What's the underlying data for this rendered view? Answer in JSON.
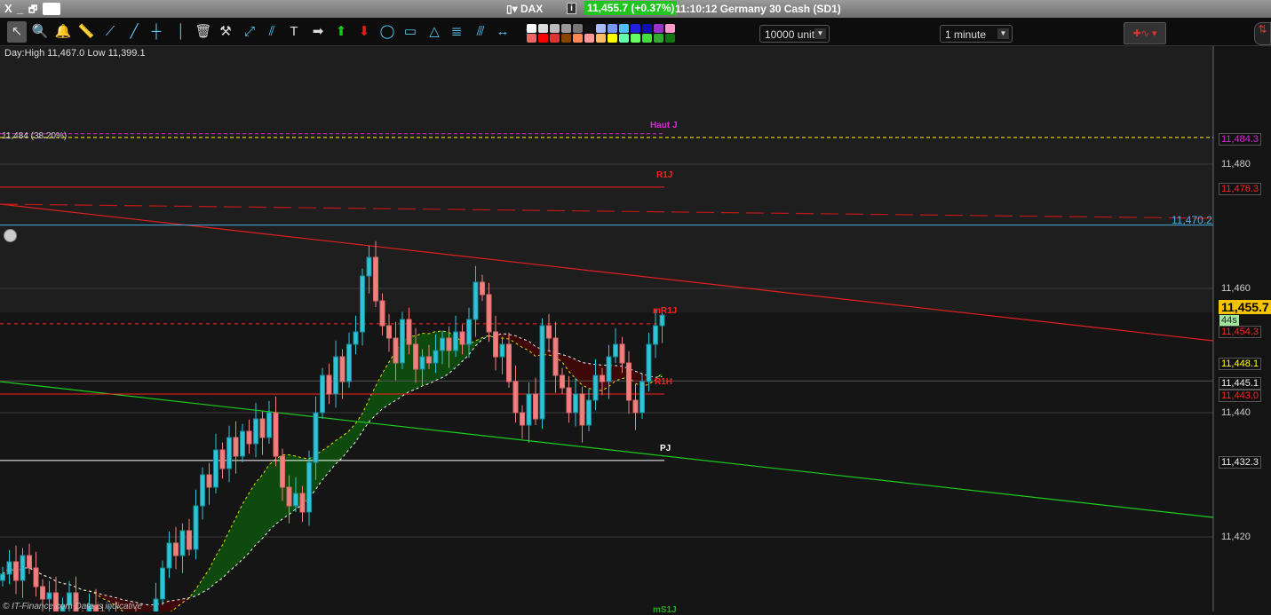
{
  "titlebar": {
    "symbol": "DAX",
    "price_badge": "11,455.7 (+0.37%)",
    "time": "11:10:12",
    "instrument": "Germany 30 Cash (SD1)",
    "info": "i"
  },
  "window_buttons": {
    "close": "X",
    "minimize": "_",
    "restore": "🗗"
  },
  "toolbar": {
    "tools": [
      {
        "name": "pointer",
        "glyph": "↖"
      },
      {
        "name": "zoom",
        "glyph": "🔍"
      },
      {
        "name": "alert",
        "glyph": "🔔"
      },
      {
        "name": "ruler",
        "glyph": "📏"
      },
      {
        "name": "segment",
        "glyph": "⟋"
      },
      {
        "name": "line",
        "glyph": "╱"
      },
      {
        "name": "horizontal-line",
        "glyph": "┼"
      },
      {
        "name": "vertical-line",
        "glyph": "│"
      },
      {
        "name": "trash",
        "glyph": "🗑"
      },
      {
        "name": "properties",
        "glyph": "⚒"
      },
      {
        "name": "scale",
        "glyph": "⤢"
      },
      {
        "name": "parallel",
        "glyph": "⫽"
      },
      {
        "name": "text",
        "glyph": "T"
      },
      {
        "name": "arrow",
        "glyph": "➡"
      },
      {
        "name": "up-arrow",
        "glyph": "⬆"
      },
      {
        "name": "down-arrow",
        "glyph": "⬇"
      },
      {
        "name": "ellipse",
        "glyph": "◯"
      },
      {
        "name": "rectangle",
        "glyph": "▭"
      },
      {
        "name": "triangle",
        "glyph": "△"
      },
      {
        "name": "fibonacci",
        "glyph": "≣"
      },
      {
        "name": "channel",
        "glyph": "⫻"
      },
      {
        "name": "measure",
        "glyph": "↔"
      },
      {
        "name": "vertical-measure",
        "glyph": "↕"
      }
    ],
    "palette": [
      "#ffffff",
      "#dddddd",
      "#bbbbbb",
      "#999999",
      "#777777",
      "#111111",
      "#aabbff",
      "#7799ff",
      "#55bbff",
      "#2222dd",
      "#1111aa",
      "#9933cc",
      "#ff99cc",
      "#ee6666",
      "#ff0000",
      "#dd3333",
      "#884400",
      "#ff8855",
      "#ff9999",
      "#ffbb66",
      "#ffff00",
      "#66ffaa",
      "#66ff66",
      "#44dd44",
      "#33aa33",
      "#117711"
    ],
    "quantity": "10000 units",
    "timeframe": "1 minute"
  },
  "chart": {
    "day_info": "Day:High 11,467.0 Low 11,399.1",
    "watermark": "© IT-Finance.com  Data is indicative",
    "fib_label": "11,484 (38.20%)",
    "last_price": "11,455.7",
    "countdown": "44s",
    "colors": {
      "up": "#2ec4d6",
      "down": "#f08080",
      "bg": "#141414"
    },
    "y_ticks": [
      "11,480",
      "11,460",
      "11,440",
      "11,420"
    ],
    "levels": [
      {
        "label": "Haut J",
        "price": "11,484.3",
        "color": "#e020e0"
      },
      {
        "label": "",
        "price": "11,484.3",
        "color": "#ffff00"
      },
      {
        "label": "R1J",
        "price": "11,476.3",
        "color": "#ff2020"
      },
      {
        "label": "",
        "price": "11,470.2",
        "color": "#4ab0e6"
      },
      {
        "label": "mR1J",
        "price": "11,454.3",
        "color": "#ff2020"
      },
      {
        "label": "",
        "price": "11,448.1",
        "color": "#ffff00"
      },
      {
        "label": "",
        "price": "11,445.1",
        "color": "#ffffff"
      },
      {
        "label": "R1H",
        "price": "11,443.0",
        "color": "#ff2020"
      },
      {
        "label": "PJ",
        "price": "11,432.3",
        "color": "#ffffff"
      },
      {
        "label": "mS1J",
        "price": "",
        "color": "#22aa22"
      }
    ]
  },
  "chart_data": {
    "type": "candlestick",
    "y_ticks": [
      11480,
      11460,
      11440,
      11420
    ],
    "closes": [
      11414,
      11416,
      11413,
      11417,
      11415,
      11412,
      11410,
      11411,
      11408,
      11409,
      11411,
      11407,
      11406,
      11409,
      11408,
      11405,
      11407,
      11406,
      11404,
      11406,
      11405,
      11403,
      11406,
      11410,
      11415,
      11419,
      11417,
      11421,
      11418,
      11425,
      11430,
      11428,
      11434,
      11431,
      11436,
      11433,
      11437,
      11435,
      11439,
      11436,
      11440,
      11433,
      11428,
      11425,
      11427,
      11424,
      11432,
      11440,
      11446,
      11443,
      11449,
      11445,
      11451,
      11453,
      11462,
      11465,
      11458,
      11454,
      11452,
      11448,
      11455,
      11451,
      11447,
      11449,
      11448,
      11450,
      11452,
      11450,
      11453,
      11451,
      11455,
      11461,
      11459,
      11453,
      11449,
      11451,
      11445,
      11440,
      11438,
      11443,
      11439,
      11454,
      11452,
      11446,
      11444,
      11440,
      11443,
      11438,
      11442,
      11446,
      11445,
      11449,
      11451,
      11448,
      11442,
      11440,
      11445,
      11451,
      11454,
      11455.7
    ]
  }
}
